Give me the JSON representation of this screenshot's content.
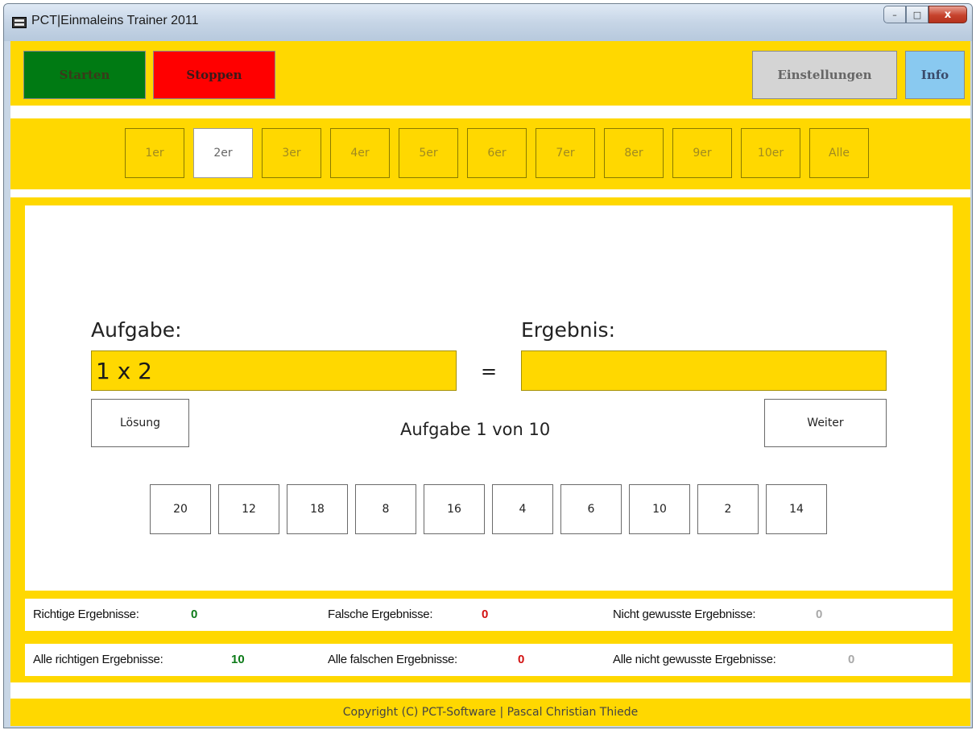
{
  "window": {
    "title": "PCT|Einmaleins Trainer 2011",
    "minimize_glyph": "–",
    "maximize_glyph": "□",
    "close_glyph": "x"
  },
  "toolbar": {
    "start_label": "Starten",
    "stop_label": "Stoppen",
    "settings_label": "Einstellungen",
    "info_label": "Info"
  },
  "rows": {
    "selected": "2er",
    "items": [
      "1er",
      "2er",
      "3er",
      "4er",
      "5er",
      "6er",
      "7er",
      "8er",
      "9er",
      "10er",
      "Alle"
    ]
  },
  "task": {
    "task_label": "Aufgabe:",
    "task_value": "1 x 2",
    "equals": "=",
    "result_label": "Ergebnis:",
    "result_value": "",
    "solution_button": "Lösung",
    "next_button": "Weiter",
    "progress_text": "Aufgabe 1 von 10",
    "choices": [
      "20",
      "12",
      "18",
      "8",
      "16",
      "4",
      "6",
      "10",
      "2",
      "14"
    ]
  },
  "stats": {
    "correct_label": "Richtige Ergebnisse:",
    "correct_value": "0",
    "wrong_label": "Falsche Ergebnisse:",
    "wrong_value": "0",
    "unknown_label": "Nicht gewusste Ergebnisse:",
    "unknown_value": "0",
    "all_correct_label": "Alle richtigen Ergebnisse:",
    "all_correct_value": "10",
    "all_wrong_label": "Alle falschen Ergebnisse:",
    "all_wrong_value": "0",
    "all_unknown_label": "Alle nicht gewusste Ergebnisse:",
    "all_unknown_value": "0"
  },
  "footer": {
    "copyright": "Copyright (C) PCT-Software | Pascal Christian Thiede"
  },
  "colors": {
    "accent_yellow": "#ffd800",
    "start_green": "#007a13",
    "stop_red": "#ff0000",
    "info_blue": "#89c9f0",
    "settings_grey": "#d4d4d4"
  }
}
